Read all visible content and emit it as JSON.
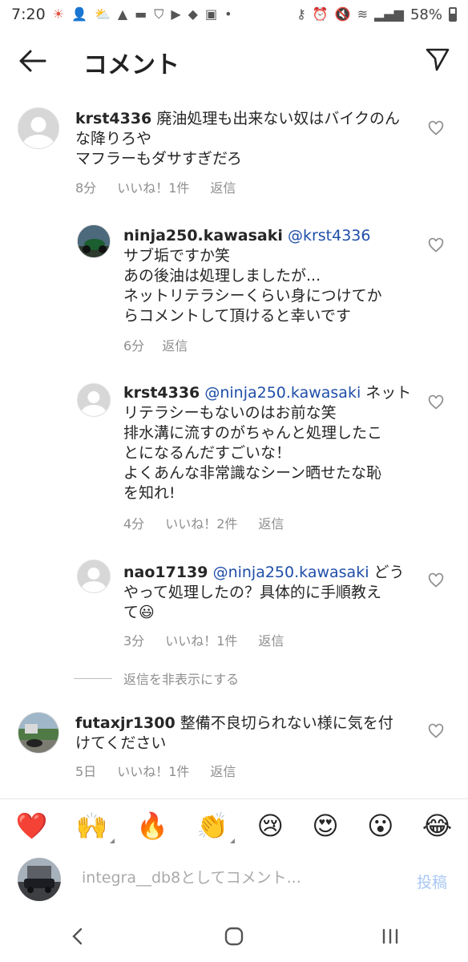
{
  "status_bar": {
    "time": "7:20",
    "battery": "58%"
  },
  "header": {
    "title": "コメント"
  },
  "comments": [
    {
      "username": "krst4336",
      "text_line1": "廃油処理も出来ない奴はバイクのん",
      "text_line2": "な降りろや",
      "text_line3": "マフラーもダサすぎだろ",
      "time": "8分",
      "likes": "いいね！1件",
      "reply": "返信"
    },
    {
      "username": "ninja250.kawasaki",
      "mention": "@krst4336",
      "text_line1": "サブ垢ですか笑",
      "text_line2": "あの後油は処理しましたが...",
      "text_line3": "ネットリテラシーくらい身につけてか",
      "text_line4": "らコメントして頂けると幸いです",
      "time": "6分",
      "reply": "返信"
    },
    {
      "username": "krst4336",
      "mention": "@ninja250.kawasaki",
      "text_line1_tail": "ネット",
      "text_line2": "リテラシーもないのはお前な笑",
      "text_line3": "排水溝に流すのがちゃんと処理したこ",
      "text_line4": "とになるんだすごいな！",
      "text_line5": "よくあんな非常識なシーン晒せたな恥",
      "text_line6": "を知れ!",
      "time": "4分",
      "likes": "いいね！2件",
      "reply": "返信"
    },
    {
      "username": "nao17139",
      "mention": "@ninja250.kawasaki",
      "text_line1_tail": "どう",
      "text_line2": "やって処理したの？具体的に手順教え",
      "text_line3": "て😃",
      "time": "3分",
      "likes": "いいね！1件",
      "reply": "返信"
    },
    {
      "username": "futaxjr1300",
      "text_line1": "整備不良切られない様に気を付",
      "text_line2": "けてください",
      "time": "5日",
      "likes": "いいね！1件",
      "reply": "返信"
    }
  ],
  "hide_replies": "返信を非表示にする",
  "emoji_bar": [
    "❤️",
    "🙌",
    "🔥",
    "👏",
    "😢",
    "😍",
    "😮",
    "😂"
  ],
  "input": {
    "placeholder": "integra__db8としてコメント...",
    "post_label": "投稿"
  },
  "colors": {
    "mention": "#1f4ea8",
    "meta": "#8e8e8e",
    "post_disabled": "#a9c7f2"
  }
}
